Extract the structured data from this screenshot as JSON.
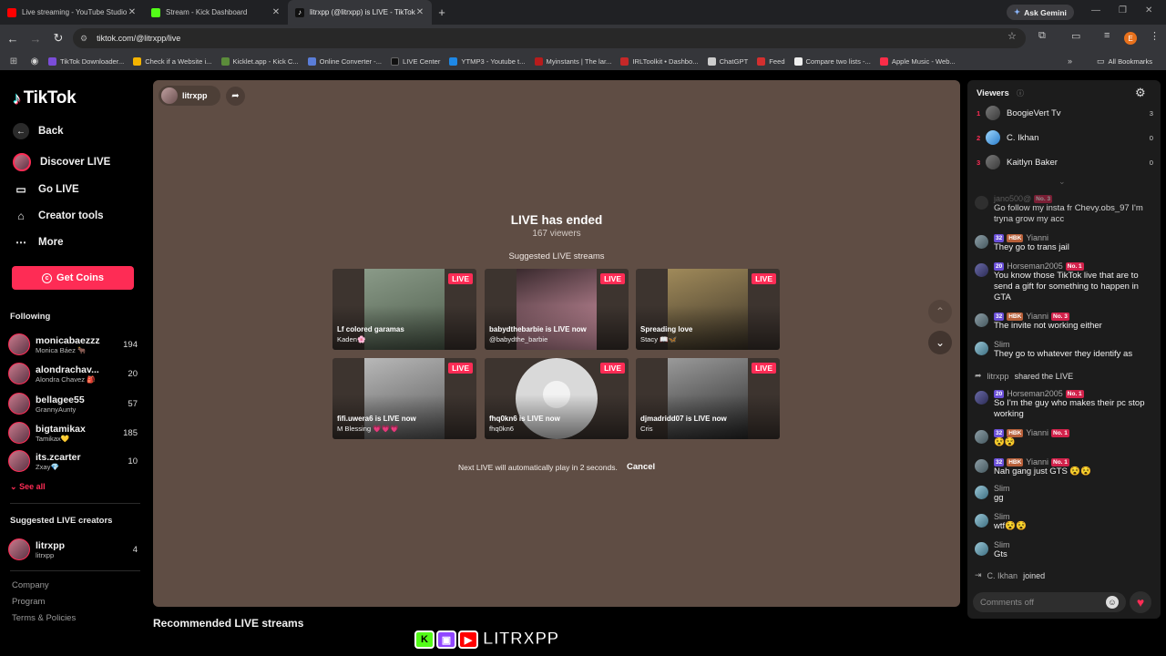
{
  "tabs": [
    {
      "title": "Live streaming - YouTube Studio",
      "favicon_color": "#ff0000"
    },
    {
      "title": "Stream - Kick Dashboard",
      "favicon_color": "#53fc18"
    },
    {
      "title": "litrxpp (@litrxpp) is LIVE - TikTok",
      "favicon_color": "#111111"
    }
  ],
  "browser": {
    "new_tab": "+",
    "ask_gemini": "Ask Gemini",
    "url": "tiktok.com/@litrxpp/live",
    "profile_initial": "E"
  },
  "bookmarks": [
    {
      "label": "TikTok Downloader...",
      "color": "#7b4dd8"
    },
    {
      "label": "Check if a Website i...",
      "color": "#f4b400"
    },
    {
      "label": "Kicklet.app - Kick C...",
      "color": "#5b8c3a"
    },
    {
      "label": "Online Converter -...",
      "color": "#5a7dd8"
    },
    {
      "label": "LIVE Center",
      "color": "#111111"
    },
    {
      "label": "YTMP3 - Youtube t...",
      "color": "#1e88e5"
    },
    {
      "label": "Myinstants | The lar...",
      "color": "#b71c1c"
    },
    {
      "label": "IRLToolkit • Dashbo...",
      "color": "#c62828"
    },
    {
      "label": "ChatGPT",
      "color": "#cccccc"
    },
    {
      "label": "Feed",
      "color": "#d32f2f"
    },
    {
      "label": "Compare two lists -...",
      "color": "#eeeeee"
    },
    {
      "label": "Apple Music - Web...",
      "color": "#fa2d48"
    }
  ],
  "bookmarks_all": "All Bookmarks",
  "sidebar": {
    "logo": "TikTok",
    "nav": [
      {
        "label": "Back",
        "icon": "arrow-left-icon"
      },
      {
        "label": "Discover LIVE",
        "icon": "discover-live-icon"
      },
      {
        "label": "Go LIVE",
        "icon": "video-camera-icon"
      },
      {
        "label": "Creator tools",
        "icon": "creator-tools-icon"
      },
      {
        "label": "More",
        "icon": "more-dots-icon"
      }
    ],
    "get_coins": "Get Coins",
    "following_heading": "Following",
    "following": [
      {
        "name": "monicabaezzz",
        "sub": "Monica Báez 🐂",
        "count": "194"
      },
      {
        "name": "alondrachav...",
        "sub": "Alondra Chavez 🎒",
        "count": "20"
      },
      {
        "name": "bellagee55",
        "sub": "GrannyAunty",
        "count": "57"
      },
      {
        "name": "bigtamikax",
        "sub": "Tamikax💛",
        "count": "185"
      },
      {
        "name": "its.zcarter",
        "sub": "Zxay💎",
        "count": "10"
      }
    ],
    "see_all": "See all",
    "suggested_heading": "Suggested LIVE creators",
    "suggested": [
      {
        "name": "litrxpp",
        "sub": "litrxpp",
        "count": "4"
      }
    ],
    "footer": [
      "Company",
      "Program",
      "Terms & Policies"
    ]
  },
  "player": {
    "host": "litrxpp",
    "ended_title": "LIVE has ended",
    "ended_viewers": "167 viewers",
    "suggested_heading": "Suggested LIVE streams",
    "live_badge": "LIVE",
    "cards": [
      {
        "title": "Lf colored garamas",
        "sub": "Kaden🌸",
        "thumb": "#6d7c6a"
      },
      {
        "title": "babydthebarbie is LIVE now",
        "sub": "@babydthe_barbie",
        "thumb": "#c98a9a"
      },
      {
        "title": "Spreading love",
        "sub": "Stacy 📖🦋",
        "thumb": "#7a6a4a"
      },
      {
        "title": "fifi.uwera6 is LIVE now",
        "sub": "M Blessing 💗💗💗",
        "thumb": "#8a8a8a"
      },
      {
        "title": "fhq0kn6 is LIVE now",
        "sub": "fhq0kn6",
        "thumb": "#bdbdbd"
      },
      {
        "title": "djmadridd07 is LIVE now",
        "sub": "Cris",
        "thumb": "#4a4a4a"
      }
    ],
    "next_text": "Next LIVE will automatically play in 2 seconds.",
    "cancel": "Cancel"
  },
  "recommended_heading": "Recommended LIVE streams",
  "overlay_logo": "LITRXPP",
  "viewers_panel": {
    "heading": "Viewers",
    "top": [
      {
        "rank": "1",
        "name": "BoogieVert Tv",
        "score": "3"
      },
      {
        "rank": "2",
        "name": "C. Ikhan",
        "score": "0"
      },
      {
        "rank": "3",
        "name": "Kaitlyn Baker",
        "score": "0"
      }
    ]
  },
  "chat": [
    {
      "name": "jano500@",
      "level": "",
      "hbk": "",
      "rank": "No. 3",
      "text": "Go follow my insta fr Chevy.obs_97 I'm tryna grow my acc"
    },
    {
      "name": "Yianni",
      "level": "32",
      "hbk": "HBK",
      "rank": "",
      "text": "They go to trans jail"
    },
    {
      "name": "Horseman2005",
      "level": "20",
      "hbk": "",
      "rank": "No. 1",
      "text": "You know those TikTok live that are to send a gift for something to happen in GTA"
    },
    {
      "name": "Yianni",
      "level": "32",
      "hbk": "HBK",
      "rank": "No. 3",
      "text": "The invite not working either"
    },
    {
      "name": "Slim",
      "level": "",
      "hbk": "",
      "rank": "",
      "text": "They go to whatever they identify as"
    },
    {
      "name": "Horseman2005",
      "level": "20",
      "hbk": "",
      "rank": "No. 1",
      "text": "So I'm the guy who makes their pc stop working"
    },
    {
      "name": "Yianni",
      "level": "32",
      "hbk": "HBK",
      "rank": "No. 1",
      "text": "😵😵"
    },
    {
      "name": "Yianni",
      "level": "32",
      "hbk": "HBK",
      "rank": "No. 1",
      "text": "Nah gang just GTS 😵😵"
    },
    {
      "name": "Slim",
      "level": "",
      "hbk": "",
      "rank": "",
      "text": "gg"
    },
    {
      "name": "Slim",
      "level": "",
      "hbk": "",
      "rank": "",
      "text": "wtf😵😵"
    },
    {
      "name": "Slim",
      "level": "",
      "hbk": "",
      "rank": "",
      "text": "Gts"
    }
  ],
  "system": [
    {
      "name": "litrxpp",
      "action": "shared the LIVE"
    },
    {
      "name": "C. Ikhan",
      "action": "joined"
    }
  ],
  "comment_placeholder": "Comments off"
}
